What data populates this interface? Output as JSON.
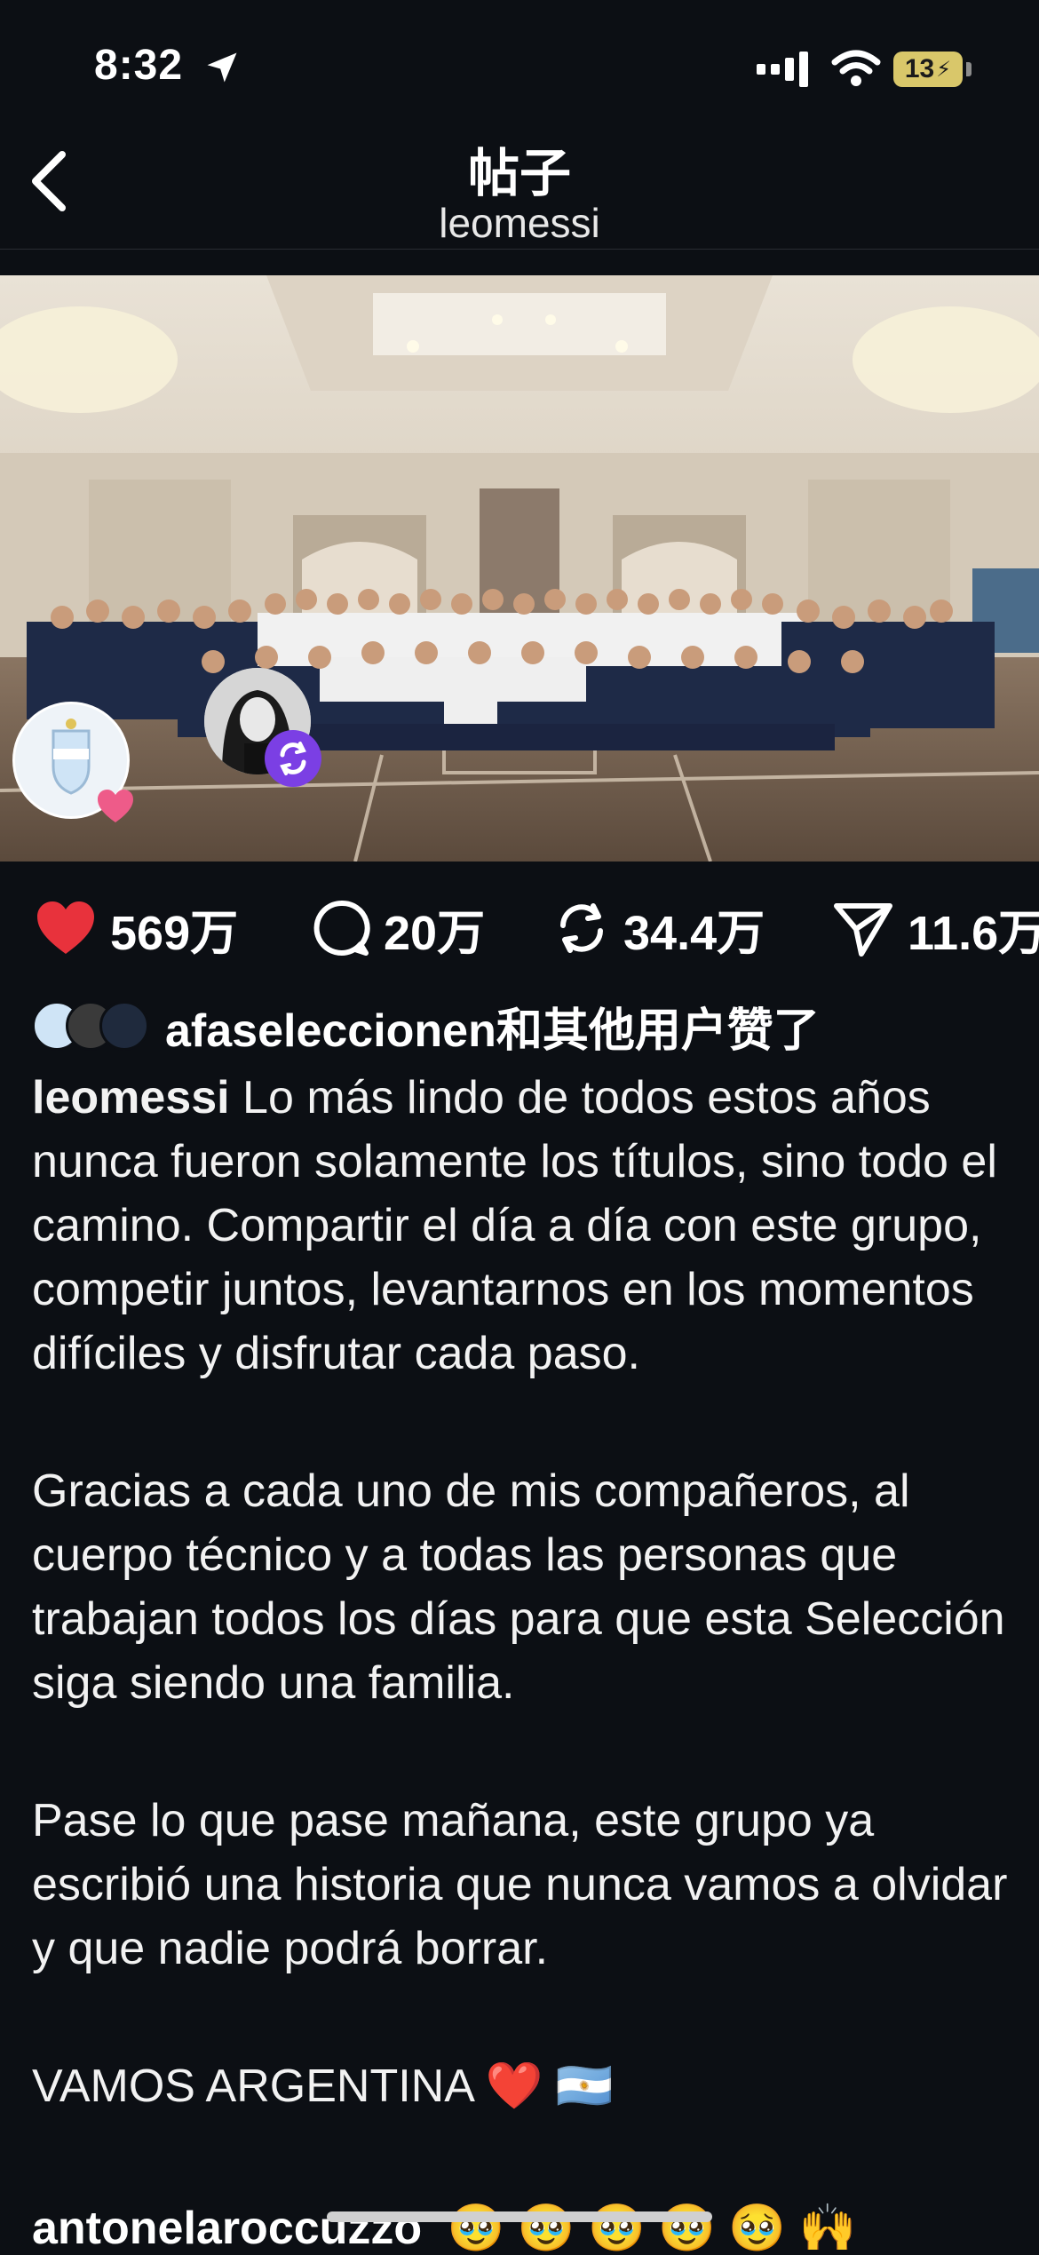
{
  "status": {
    "time": "8:32",
    "battery": "13"
  },
  "header": {
    "title": "帖子",
    "username": "leomessi"
  },
  "actions": {
    "likes": "569万",
    "comments": "20万",
    "reposts": "34.4万",
    "shares": "11.6万"
  },
  "liked_by": {
    "user": "afaseleccionen",
    "suffix": "和其他用户赞了"
  },
  "caption": {
    "user": "leomessi",
    "paragraph1": "Lo más lindo de todos estos años nunca fueron solamente los títulos, sino todo el camino. Compartir el día a día con este grupo, competir juntos, levantarnos en los momentos difíciles y disfrutar cada paso.",
    "paragraph2": "Gracias a cada uno de mis compañeros, al cuerpo técnico y a todas las personas que trabajan todos los días para que esta Selección siga siendo una familia.",
    "paragraph3": "Pase lo que pase mañana, este grupo ya escribió una historia que nunca vamos a olvidar y que nadie podrá borrar.",
    "paragraph4": "VAMOS ARGENTINA ❤️ 🇦🇷"
  },
  "next_comment": {
    "user": "antonelaroccuzzo",
    "text": "🥹 🥹 🥹 🥹 🥹 🙌"
  },
  "colors": {
    "background": "#0c0f14",
    "like": "#e8323c",
    "repost_badge": "#7b3fe4"
  }
}
